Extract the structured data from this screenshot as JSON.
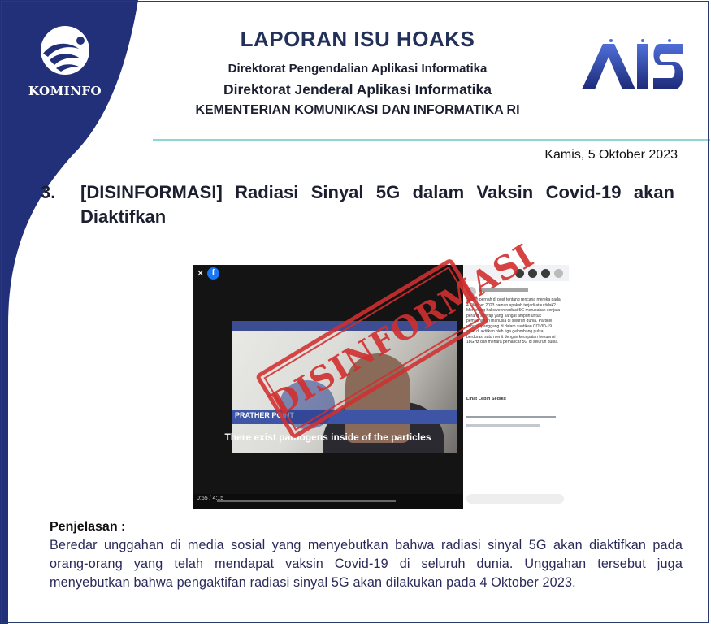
{
  "header": {
    "brand": "KOMINFO",
    "title": "LAPORAN ISU HOAKS",
    "subtitle1": "Direktorat Pengendalian Aplikasi Informatika",
    "subtitle2": "Direktorat Jenderal Aplikasi Informatika",
    "subtitle3": "KEMENTERIAN KOMUNIKASI DAN INFORMATIKA RI",
    "logo_right": "AIS"
  },
  "date": "Kamis, 5 Oktober 2023",
  "item": {
    "number": "3.",
    "title": "[DISINFORMASI] Radiasi Sinyal 5G dalam Vaksin Covid-19 akan Diaktifkan"
  },
  "screenshot": {
    "stamp": "DISINFORMASI",
    "video_caption": "There exist pathogens inside of the particles",
    "lower_third": "PRATHER POINT",
    "video_time": "0:55 / 4:15",
    "post_text": "Sudah pernah di post tentang rencana mereka pada 4 Oktober 2023 namun apakah terjadi atau tidak? Menjelang halloween radiasi 5G merupakan senjata perang senyap yang sangat ampuh untuk pemusnahan manusia di seluruh dunia. Partikel yang terpanggang di dalam suntikan COVID-19 akan di aktifkan oleh tiga gelombang pulsa berdurasi satu menit dengan kecepatan frekuensi 18GHz dari menara pemancar 5G di seluruh dunia.",
    "see_more": "Lihat Lebih Sedikit"
  },
  "explanation": {
    "heading": "Penjelasan :",
    "body": "Beredar unggahan di media sosial yang menyebutkan bahwa radiasi sinyal 5G akan diaktifkan pada orang-orang yang telah mendapat vaksin Covid-19 di seluruh dunia. Unggahan tersebut juga menyebutkan bahwa pengaktifan radiasi sinyal 5G akan dilakukan pada 4 Oktober 2023."
  },
  "colors": {
    "navy": "#22307a",
    "teal_rule": "#8fd7d6",
    "stamp_red": "#d12f2f"
  }
}
